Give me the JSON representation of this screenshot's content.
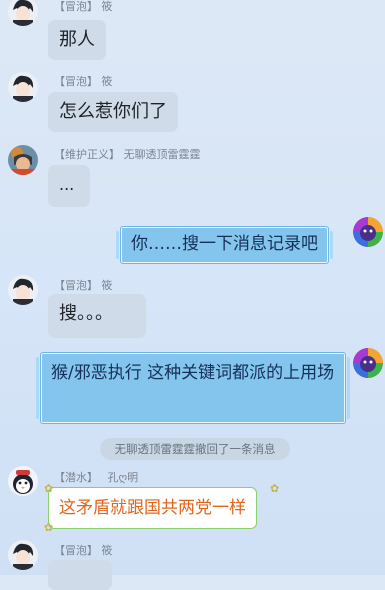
{
  "messages": [
    {
      "meta_tag": "【冒泡】",
      "sender": "筱",
      "text": "那人"
    },
    {
      "meta_tag": "【冒泡】",
      "sender": "筱",
      "text": "怎么惹你们了"
    },
    {
      "meta_tag": "【维护正义】",
      "sender": "无聊透顶雷霆霆",
      "text": "..."
    },
    {
      "text": "你……搜一下消息记录吧"
    },
    {
      "meta_tag": "【冒泡】",
      "sender": "筱",
      "text": "搜。。。"
    },
    {
      "text": "猴/邪恶执行 这种关键词都派的上用场"
    },
    {
      "meta_tag": "【潜水】",
      "sender": "孔ღ明",
      "text": "这矛盾就跟国共两党一样"
    },
    {
      "meta_tag": "【冒泡】",
      "sender": "筱",
      "text": ""
    }
  ],
  "system_notice": "无聊透顶雷霆霆撤回了一条消息"
}
